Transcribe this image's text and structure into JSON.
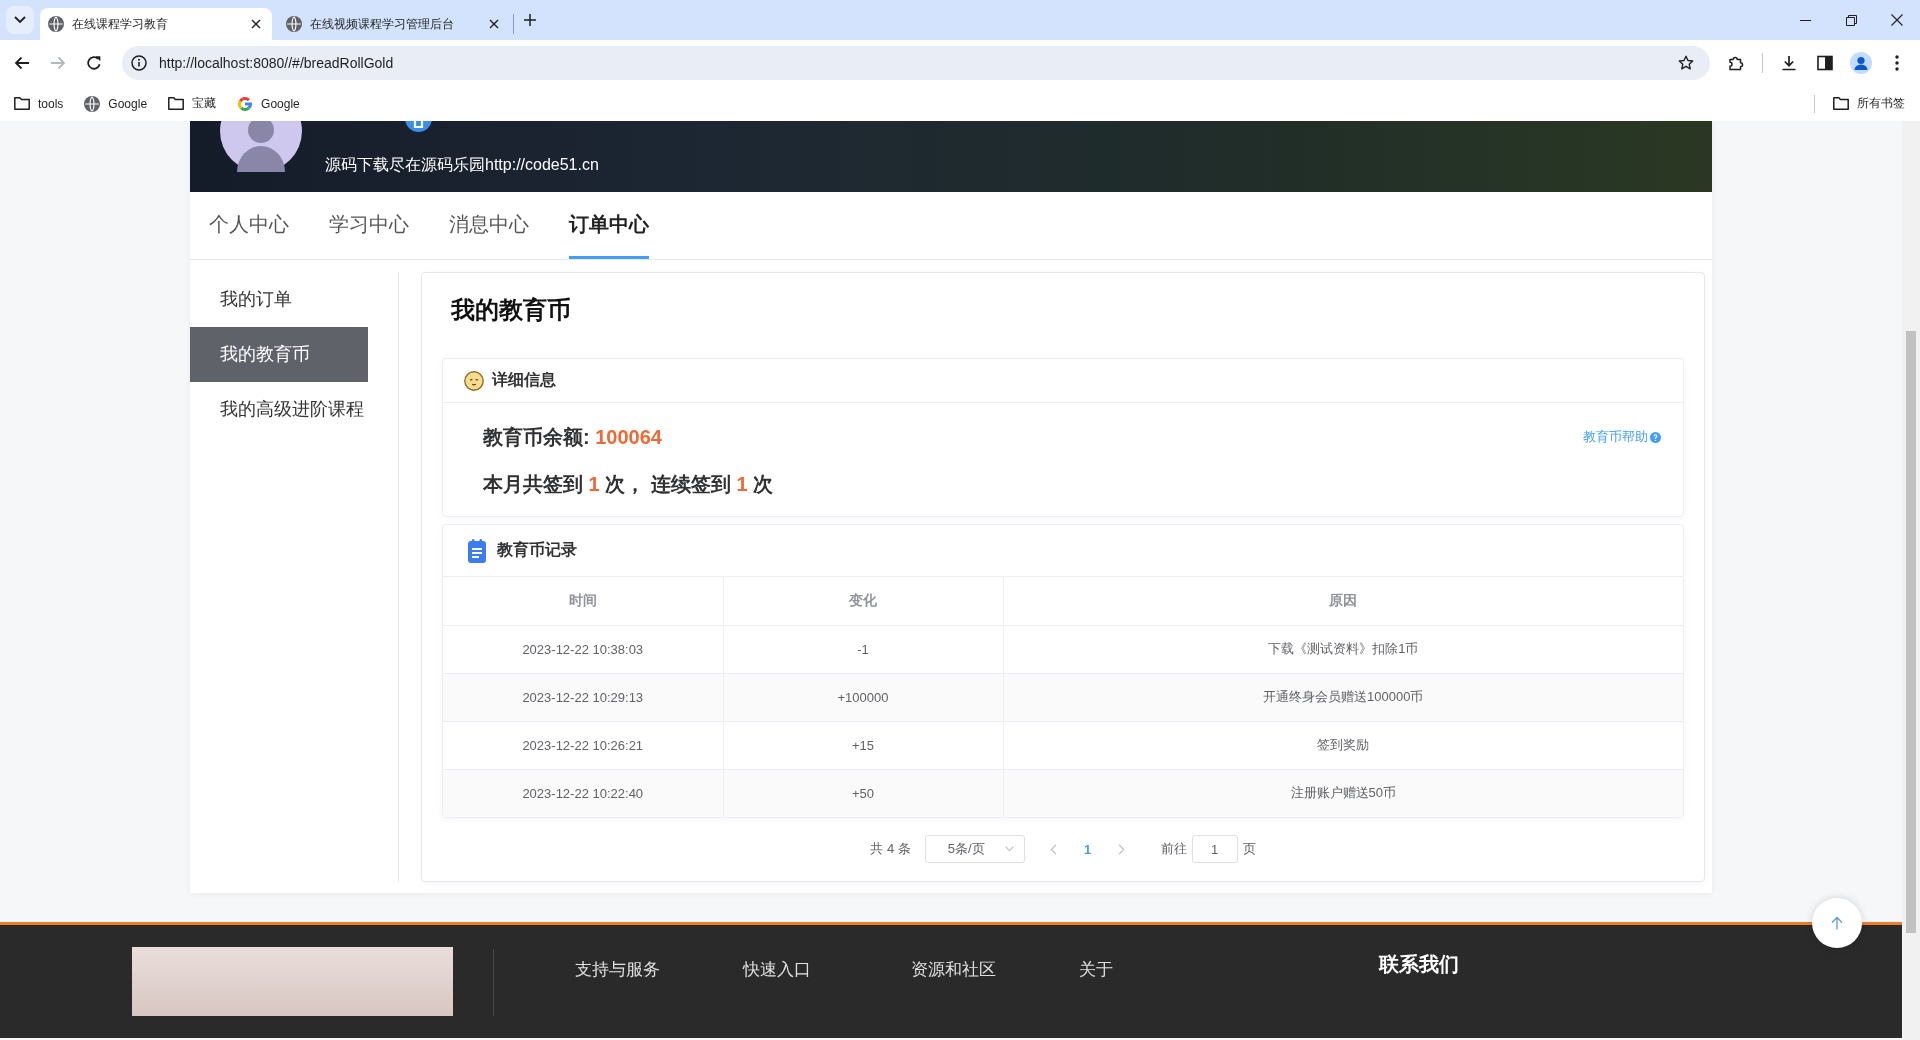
{
  "browser": {
    "tabs": [
      {
        "title": "在线课程学习教育",
        "selected": true
      },
      {
        "title": "在线视频课程学习管理后台",
        "selected": false
      }
    ],
    "nav_buttons": [
      {
        "kind": "back",
        "disabled": false
      },
      {
        "kind": "forward",
        "disabled": true
      },
      {
        "kind": "reload",
        "disabled": false
      }
    ],
    "url": "http://localhost:8080//#/breadRollGold",
    "bookmarks": [
      {
        "kind": "folder",
        "label": "tools"
      },
      {
        "kind": "site",
        "label": "Google"
      },
      {
        "kind": "folder",
        "label": "宝藏"
      },
      {
        "kind": "g_logo",
        "label": "Google"
      }
    ],
    "all_bookmarks": "所有书签"
  },
  "banner": {
    "signature": "源码下载尽在源码乐园http://code51.cn"
  },
  "nav_tabs": [
    {
      "label": "个人中心",
      "selected": false
    },
    {
      "label": "学习中心",
      "selected": false
    },
    {
      "label": "消息中心",
      "selected": false
    },
    {
      "label": "订单中心",
      "selected": true
    }
  ],
  "sidebar": [
    {
      "label": "我的订单",
      "selected": false
    },
    {
      "label": "我的教育币",
      "selected": true
    },
    {
      "label": "我的高级进阶课程",
      "selected": false
    }
  ],
  "coins": {
    "title": "我的教育币",
    "details": {
      "title": "详细信息",
      "help_link": "教育币帮助",
      "balance": {
        "label": "教育币余额:",
        "value": "100064"
      },
      "sign_in": [
        {
          "kind": "text",
          "text": "本月共签到"
        },
        {
          "kind": "count",
          "text": "1"
        },
        {
          "kind": "text",
          "text": "次，"
        },
        {
          "kind": "text",
          "text": "连续签到"
        },
        {
          "kind": "count",
          "text": "1"
        },
        {
          "kind": "text",
          "text": "次"
        }
      ]
    },
    "records": {
      "title": "教育币记录",
      "columns": [
        "时间",
        "变化",
        "原因"
      ],
      "rows": [
        [
          "2023-12-22 10:38:03",
          "-1",
          "下载《测试资料》扣除1币"
        ],
        [
          "2023-12-22 10:29:13",
          "+100000",
          "开通终身会员赠送100000币"
        ],
        [
          "2023-12-22 10:26:21",
          "+15",
          "签到奖励"
        ],
        [
          "2023-12-22 10:22:40",
          "+50",
          "注册账户赠送50币"
        ]
      ]
    },
    "pagination": {
      "total": "共 4 条",
      "page_size": "5条/页",
      "prev_disabled": true,
      "pages": [
        {
          "label": "1",
          "selected": true
        }
      ],
      "next_disabled": true,
      "goto_label": "前往",
      "goto_value": "1",
      "goto_unit": "页"
    }
  },
  "footer": {
    "columns": [
      "支持与服务",
      "快速入口",
      "资源和社区",
      "关于"
    ],
    "contact_title": "联系我们"
  }
}
